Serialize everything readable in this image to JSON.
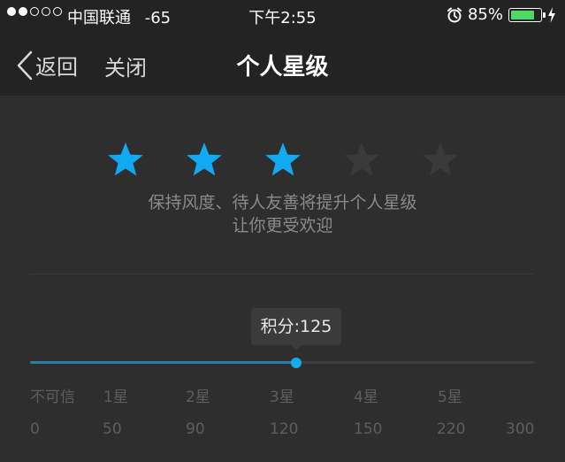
{
  "status_bar": {
    "signal_filled": 2,
    "signal_total": 5,
    "carrier": "中国联通",
    "signal_strength": "-65",
    "time": "下午2:55",
    "battery": "85%",
    "battery_level": 0.85,
    "battery_color": "#4cd964",
    "icons": [
      "alarm-icon",
      "battery-icon",
      "charging-bolt-icon"
    ]
  },
  "nav": {
    "back_label": "返回",
    "close_label": "关闭",
    "title": "个人星级"
  },
  "rating": {
    "filled": 3,
    "total": 5,
    "filled_color": "#11aaf2",
    "empty_color": "#3a3a3a",
    "tip_line1": "保持风度、待人友善将提升个人星级",
    "tip_line2": "让你更受欢迎"
  },
  "score": {
    "label": "积分:125",
    "value": 125,
    "min": 0,
    "max": 300,
    "accent": "#16aaf0"
  },
  "scale": {
    "levels": [
      "不可信",
      "1星",
      "2星",
      "3星",
      "4星",
      "5星"
    ],
    "ticks": [
      "0",
      "50",
      "90",
      "120",
      "150",
      "220",
      "300"
    ]
  }
}
